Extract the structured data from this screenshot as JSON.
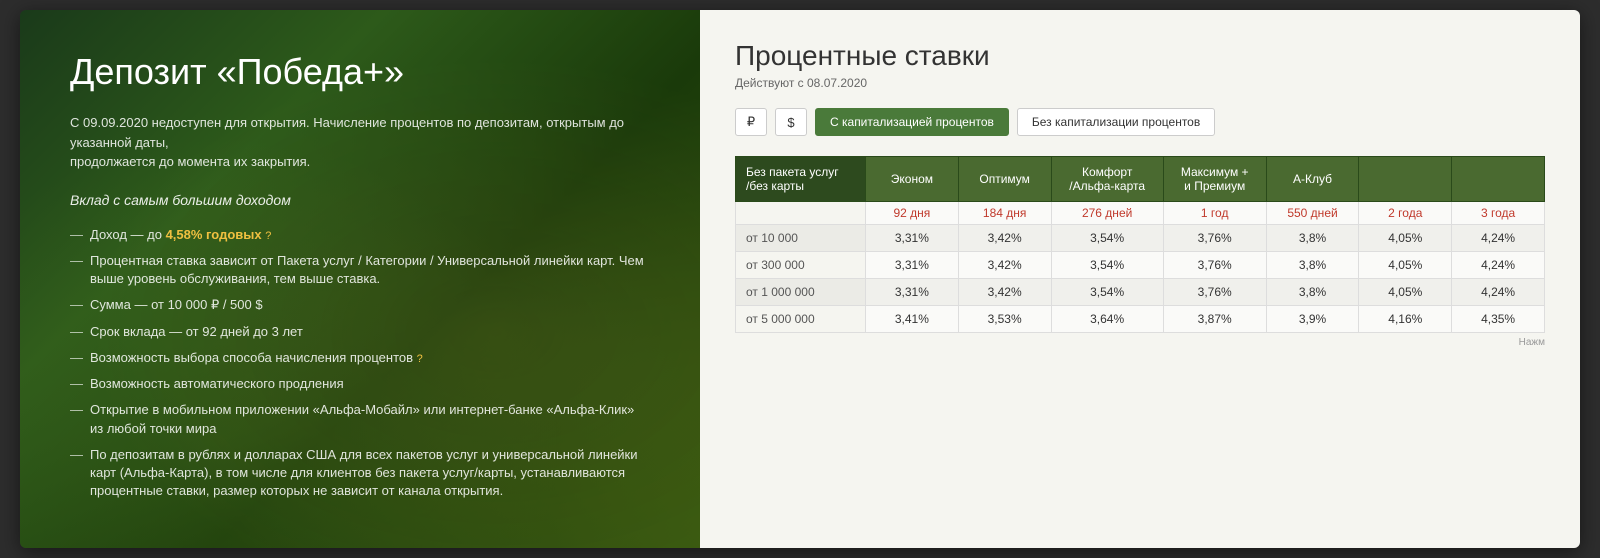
{
  "left": {
    "title": "Депозит «Победа+»",
    "warning": "С 09.09.2020 недоступен для открытия. Начисление процентов по депозитам, открытым до указанной даты,\nпродолжается до момента их закрытия.",
    "subtitle": "Вклад с самым большим доходом",
    "features": [
      {
        "text": "Доход — до 4,58% годовых",
        "highlight": "4,58%"
      },
      {
        "text": "Процентная ставка зависит от Пакета услуг / Категории / Универсальной линейки карт. Чем выше уровень обслуживания, тем выше ставка."
      },
      {
        "text": "Сумма — от 10 000 ₽ / 500 $"
      },
      {
        "text": "Срок вклада — от 92 дней до 3 лет"
      },
      {
        "text": "Возможность выбора способа начисления процентов",
        "highlight": "?"
      },
      {
        "text": "Возможность автоматического продления"
      },
      {
        "text": "Открытие в мобильном приложении «Альфа-Мобайл» или интернет-банке «Альфа-Клик» из любой точки мира"
      },
      {
        "text": "По депозитам в рублях и долларах США для всех пакетов услуг и универсальной линейки карт (Альфа-Карта), в том числе для клиентов без пакета услуг/карты, устанавливаются процентные ставки, размер которых не зависит от канала открытия."
      }
    ]
  },
  "right": {
    "title": "Процентные ставки",
    "effective_date": "Действуют с 08.07.2020",
    "currency_buttons": [
      "₽",
      "$"
    ],
    "tabs": [
      {
        "label": "С капитализацией процентов",
        "active": true
      },
      {
        "label": "Без капитализации процентов",
        "active": false
      }
    ],
    "table_headers": [
      "Без пакета услуг\n/без карты",
      "Эконом",
      "Оптимум",
      "Комфорт\n/Альфа-карта",
      "Максимум +\nи Премиум",
      "А-Клуб"
    ],
    "periods": [
      "92 дня",
      "184 дня",
      "276 дней",
      "1 год",
      "550 дней",
      "2 года",
      "3 года"
    ],
    "rows": [
      {
        "amount": "от 10 000",
        "values": [
          "3,31%",
          "3,42%",
          "3,54%",
          "3,76%",
          "3,8%",
          "4,05%",
          "4,24%"
        ]
      },
      {
        "amount": "от 300 000",
        "values": [
          "3,31%",
          "3,42%",
          "3,54%",
          "3,76%",
          "3,8%",
          "4,05%",
          "4,24%"
        ]
      },
      {
        "amount": "от 1 000 000",
        "values": [
          "3,31%",
          "3,42%",
          "3,54%",
          "3,76%",
          "3,8%",
          "4,05%",
          "4,24%"
        ]
      },
      {
        "amount": "от 5 000 000",
        "values": [
          "3,41%",
          "3,53%",
          "3,64%",
          "3,87%",
          "3,9%",
          "4,16%",
          "4,35%"
        ]
      }
    ],
    "scroll_note": "Нажм"
  }
}
